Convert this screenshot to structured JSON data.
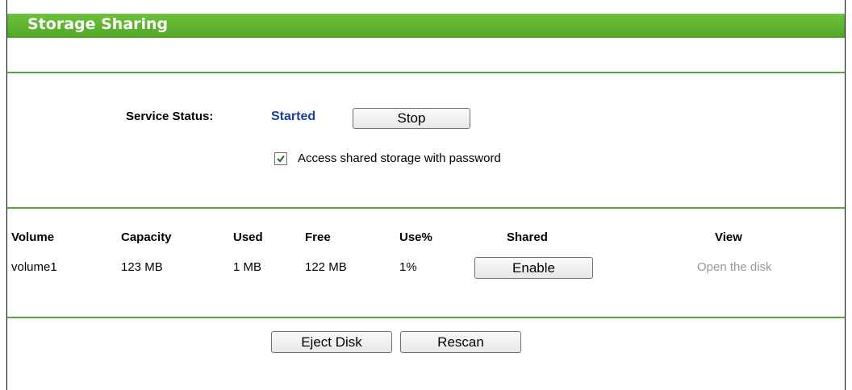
{
  "header": {
    "title": "Storage Sharing"
  },
  "service": {
    "label": "Service Status:",
    "status": "Started",
    "status_color": "#1f3f9f",
    "stop_label": "Stop",
    "password_checked": true,
    "password_label": "Access shared storage with password"
  },
  "table": {
    "headers": {
      "volume": "Volume",
      "capacity": "Capacity",
      "used": "Used",
      "free": "Free",
      "usepct": "Use%",
      "shared": "Shared",
      "view": "View"
    },
    "rows": [
      {
        "volume": "volume1",
        "capacity": "123 MB",
        "used": "1 MB",
        "free": "122 MB",
        "usepct": "1%",
        "shared_button": "Enable",
        "view_link": "Open the disk"
      }
    ]
  },
  "actions": {
    "eject_label": "Eject Disk",
    "rescan_label": "Rescan"
  },
  "colors": {
    "title_bar": "#5cb82e",
    "divider": "#5aa640",
    "disabled_text": "#999999"
  }
}
